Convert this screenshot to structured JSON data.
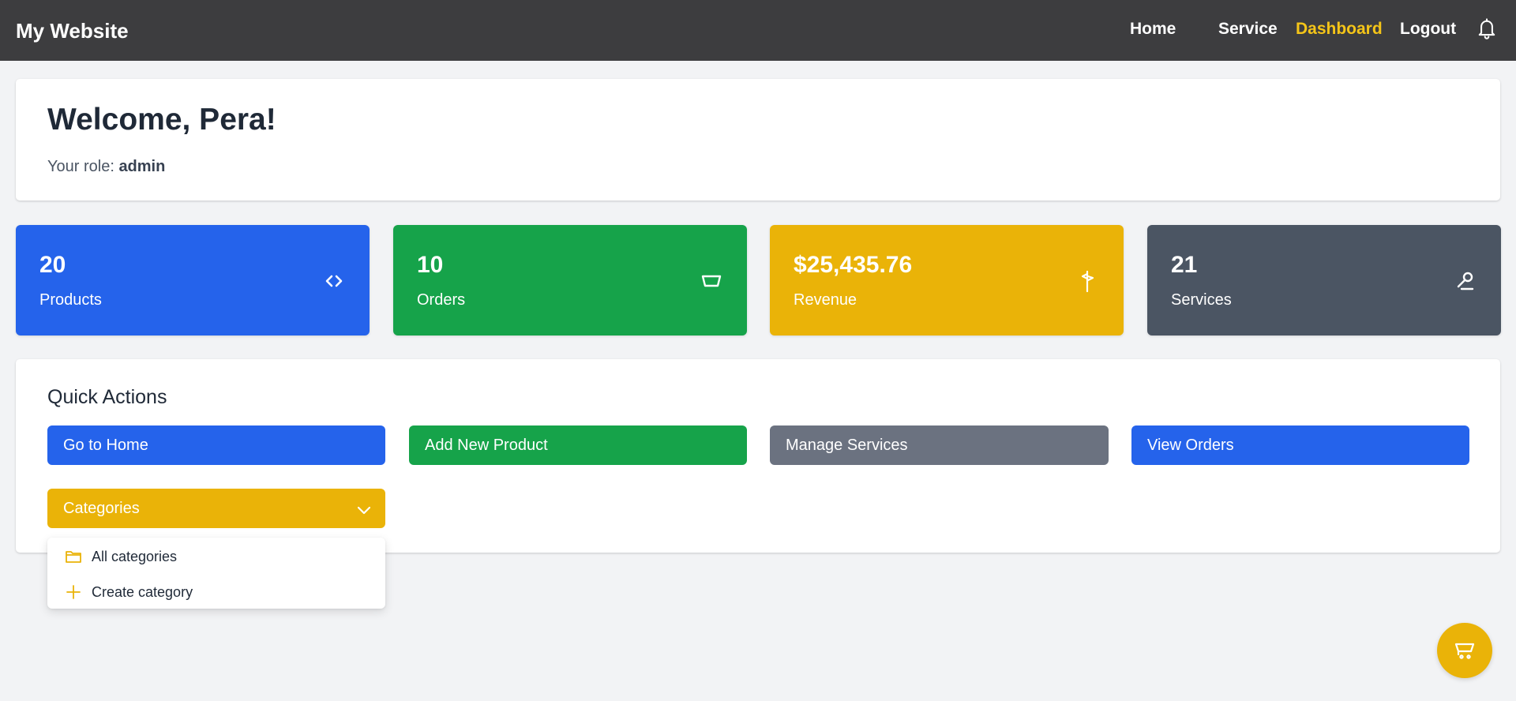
{
  "navbar": {
    "brand": "My Website",
    "links": {
      "home": "Home",
      "service": "Service",
      "dashboard": "Dashboard",
      "logout": "Logout"
    },
    "active_color": "#f5c518",
    "notification_icon": "bell-icon"
  },
  "welcome": {
    "title": "Welcome, Pera!",
    "role_label": "Your role:",
    "role_value": "admin"
  },
  "stats": [
    {
      "value": "20",
      "label": "Products",
      "color": "#2563eb",
      "icon": "code-icon"
    },
    {
      "value": "10",
      "label": "Orders",
      "color": "#16a34a",
      "icon": "basket-icon"
    },
    {
      "value": "$25,435.76",
      "label": "Revenue",
      "color": "#eab308",
      "icon": "signpost-icon"
    },
    {
      "value": "21",
      "label": "Services",
      "color": "#4b5563",
      "icon": "wrench-icon"
    }
  ],
  "quick_actions": {
    "title": "Quick Actions",
    "buttons": {
      "home": "Go to Home",
      "add_product": "Add New Product",
      "manage_services": "Manage Services",
      "view_orders": "View Orders",
      "categories": "Categories"
    },
    "categories_menu": [
      {
        "label": "All categories",
        "icon": "folder-icon"
      },
      {
        "label": "Create category",
        "icon": "plus-icon"
      }
    ]
  },
  "cart_button": {
    "icon": "cart-icon",
    "color": "#eab308"
  }
}
